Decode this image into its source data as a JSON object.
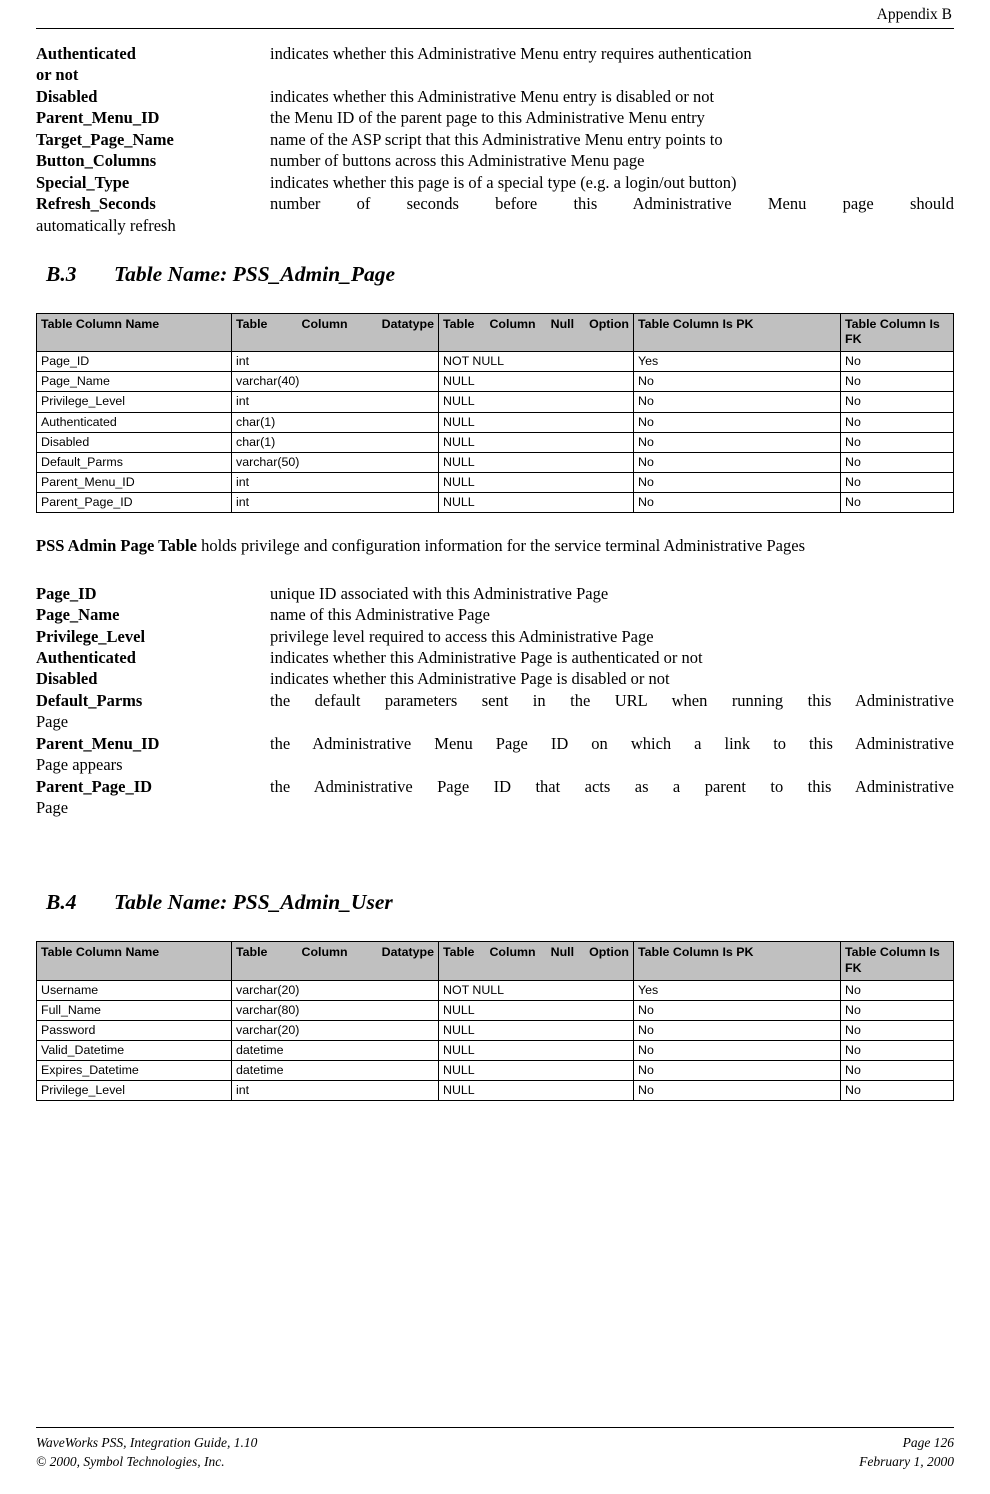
{
  "header": {
    "title": "Appendix B"
  },
  "top_definitions": [
    {
      "term": "Authenticated or not",
      "term_first_line": "Authenticated",
      "term_second_line": "or not",
      "desc": "indicates whether this Administrative Menu entry requires authentication"
    },
    {
      "term": "Disabled",
      "desc": "indicates whether this Administrative Menu entry is disabled or not"
    },
    {
      "term": "Parent_Menu_ID",
      "desc": "the Menu ID of the parent page to this Administrative Menu entry"
    },
    {
      "term": "Target_Page_Name",
      "desc": "name of the ASP script that this Administrative Menu entry points to"
    },
    {
      "term": "Button_Columns",
      "desc": "number of buttons across this Administrative Menu page"
    },
    {
      "term": "Special_Type",
      "desc": "indicates whether this page is of a special type (e.g. a login/out button)"
    },
    {
      "term": "Refresh_Seconds",
      "desc": "number of seconds before this Administrative Menu page should",
      "continuation": "automatically refresh"
    }
  ],
  "sections": [
    {
      "number": "B.3",
      "title": "Table Name: PSS_Admin_Page"
    },
    {
      "number": "B.4",
      "title": "Table Name: PSS_Admin_User"
    }
  ],
  "table1": {
    "headers": [
      "Table Column Name",
      "Table Column Datatype",
      "Table Column Null Option",
      "Table Column Is PK",
      "Table Column Is FK"
    ],
    "rows": [
      [
        "Page_ID",
        "int",
        "NOT NULL",
        "Yes",
        "No"
      ],
      [
        "Page_Name",
        "varchar(40)",
        "NULL",
        "No",
        "No"
      ],
      [
        "Privilege_Level",
        "int",
        "NULL",
        "No",
        "No"
      ],
      [
        "Authenticated",
        "char(1)",
        "NULL",
        "No",
        "No"
      ],
      [
        "Disabled",
        "char(1)",
        "NULL",
        "No",
        "No"
      ],
      [
        "Default_Parms",
        "varchar(50)",
        "NULL",
        "No",
        "No"
      ],
      [
        "Parent_Menu_ID",
        "int",
        "NULL",
        "No",
        "No"
      ],
      [
        "Parent_Page_ID",
        "int",
        "NULL",
        "No",
        "No"
      ]
    ]
  },
  "paragraph1": {
    "bold_lead": "PSS Admin Page Table",
    "rest": " holds privilege and configuration information for the service terminal Administrative Pages"
  },
  "mid_definitions": [
    {
      "term": "Page_ID",
      "desc": "unique ID associated with this Administrative Page"
    },
    {
      "term": "Page_Name",
      "desc": "name of this Administrative Page"
    },
    {
      "term": "Privilege_Level",
      "desc": "privilege level required to access this Administrative Page"
    },
    {
      "term": "Authenticated",
      "desc": "indicates whether this Administrative Page is authenticated or not"
    },
    {
      "term": "Disabled",
      "desc": "indicates whether this Administrative Page is disabled or not"
    },
    {
      "term": "Default_Parms",
      "desc": "the default parameters sent in the URL when running this Administrative",
      "continuation": "Page"
    },
    {
      "term": "Parent_Menu_ID",
      "desc": "the Administrative Menu Page ID on which a link to this Administrative",
      "continuation": "Page appears"
    },
    {
      "term": "Parent_Page_ID",
      "desc": "the Administrative Page ID that acts as a parent to this Administrative",
      "continuation": "Page"
    }
  ],
  "table2": {
    "headers": [
      "Table Column Name",
      "Table Column Datatype",
      "Table Column Null Option",
      "Table Column Is PK",
      "Table Column Is FK"
    ],
    "rows": [
      [
        "Username",
        "varchar(20)",
        "NOT NULL",
        "Yes",
        "No"
      ],
      [
        "Full_Name",
        "varchar(80)",
        "NULL",
        "No",
        "No"
      ],
      [
        "Password",
        "varchar(20)",
        "NULL",
        "No",
        "No"
      ],
      [
        "Valid_Datetime",
        "datetime",
        "NULL",
        "No",
        "No"
      ],
      [
        "Expires_Datetime",
        "datetime",
        "NULL",
        "No",
        "No"
      ],
      [
        "Privilege_Level",
        "int",
        "NULL",
        "No",
        "No"
      ]
    ]
  },
  "footer": {
    "left_line1": "WaveWorks PSS, Integration Guide, 1.10",
    "left_line2": "© 2000, Symbol Technologies, Inc.",
    "right_line1": "Page 126",
    "right_line2": "February 1, 2000"
  }
}
